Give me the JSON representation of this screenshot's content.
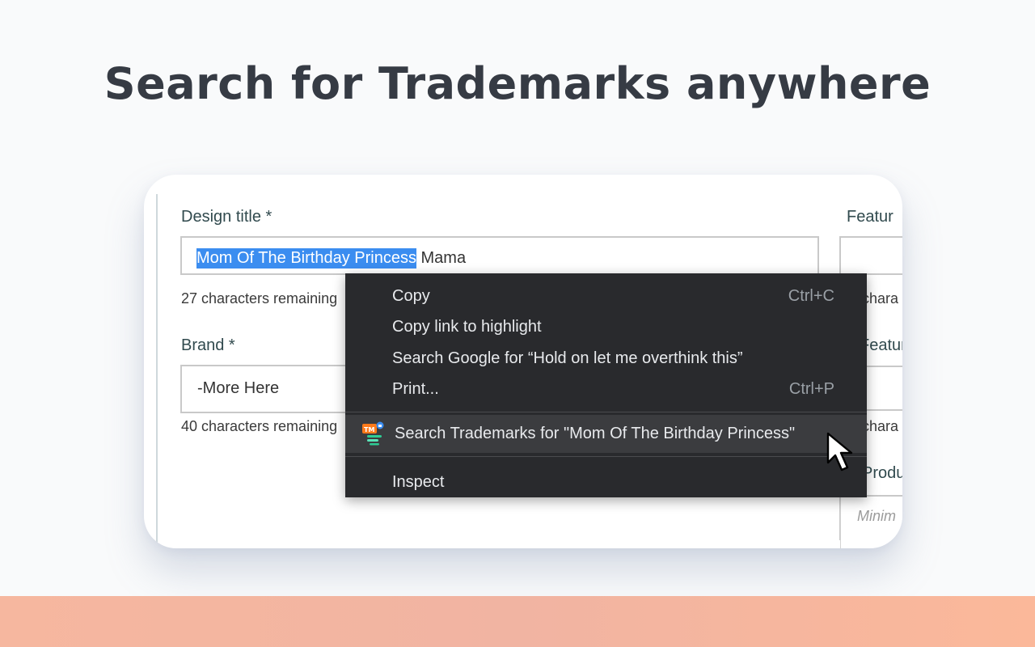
{
  "headline": "Search for Trademarks anywhere",
  "form": {
    "design_title_label": "Design title *",
    "design_title_selected": "Mom Of The Birthday Princess",
    "design_title_rest": " Mama",
    "design_title_hint": "27 characters remaining",
    "brand_label": "Brand *",
    "brand_value": "-More Here",
    "brand_hint": "40 characters remaining",
    "feature_label_1": "Featur",
    "feature_hint_1": "chara",
    "feature_label_2": "Featur",
    "feature_hint_2": "chara",
    "product_label": "Product",
    "minimum_hint": "Minim"
  },
  "context_menu": {
    "items": [
      {
        "label": "Copy",
        "shortcut": "Ctrl+C"
      },
      {
        "label": "Copy link to highlight",
        "shortcut": ""
      },
      {
        "label": "Search Google for “Hold on let me overthink this”",
        "shortcut": ""
      },
      {
        "label": "Print...",
        "shortcut": "Ctrl+P"
      }
    ],
    "trademark_item": "Search Trademarks for \"Mom Of The Birthday Princess\"",
    "trademark_icon": "trademark-extension-icon",
    "inspect": "Inspect"
  },
  "colors": {
    "selection": "#3b8df0",
    "menu_bg": "#292a2d",
    "menu_highlight": "#3b3c3f",
    "bottom_band": "#f6b79f",
    "headline": "#363b44"
  }
}
